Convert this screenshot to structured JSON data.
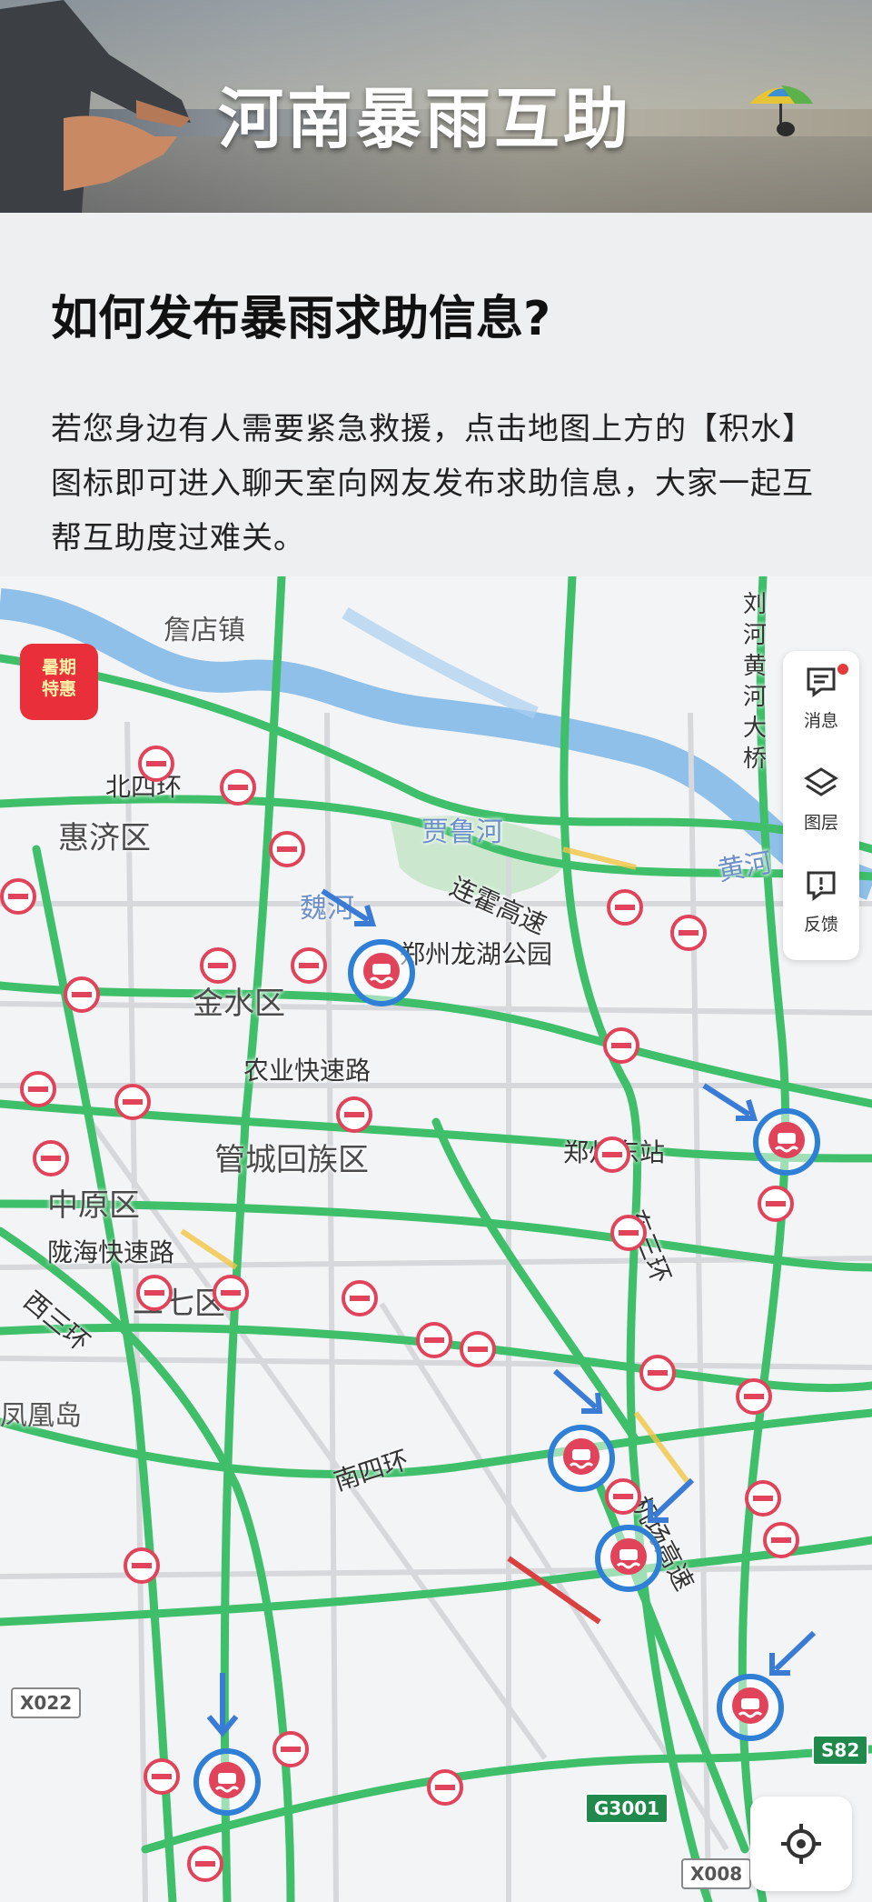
{
  "banner": {
    "title": "河南暴雨互助"
  },
  "article": {
    "heading": "如何发布暴雨求助信息?",
    "paragraph": "若您身边有人需要紧急救援，点击地图上方的【积水】图标即可进入聊天室向网友发布求助信息，大家一起互帮互助度过难关。"
  },
  "map": {
    "promo_badge": {
      "line1": "暑期",
      "line2": "特惠"
    },
    "side_panel": {
      "messages": "消息",
      "layers": "图层",
      "feedback": "反馈"
    },
    "labels": {
      "zhandian": "詹店镇",
      "huiji": "惠济区",
      "beisihuan": "北四环",
      "jialuhe": "贾鲁河",
      "weihe": "魏河",
      "lianhuo": "连霍高速",
      "longhu": "郑州龙湖公园",
      "jinshui": "金水区",
      "nongye": "农业快速路",
      "guancheng": "管城回族区",
      "zhengzhoudong": "郑州东站",
      "zhongyuan": "中原区",
      "longhai": "陇海快速路",
      "erqi": "二七区",
      "xisanhuan": "西三环",
      "dongsanhuan": "东三环",
      "fenghuang": "凤凰岛",
      "nansihuan": "南四环",
      "jichang": "机场高速",
      "huanghe": "黄河",
      "liuhe": "刘河黄河大桥"
    },
    "shields": {
      "x022": "X022",
      "x008": "X008",
      "g3001": "G3001",
      "s82": "S82"
    },
    "icons": {
      "closure": "road-closed-icon",
      "flood": "waterlogging-icon",
      "arrow": "arrow-icon",
      "locate": "locate-icon"
    },
    "colors": {
      "road": "#3fbf6a",
      "river": "#8ec0ea",
      "closure": "#e0435a",
      "flood_ring": "#2f7fd6",
      "arrow": "#3a7bd5"
    }
  }
}
